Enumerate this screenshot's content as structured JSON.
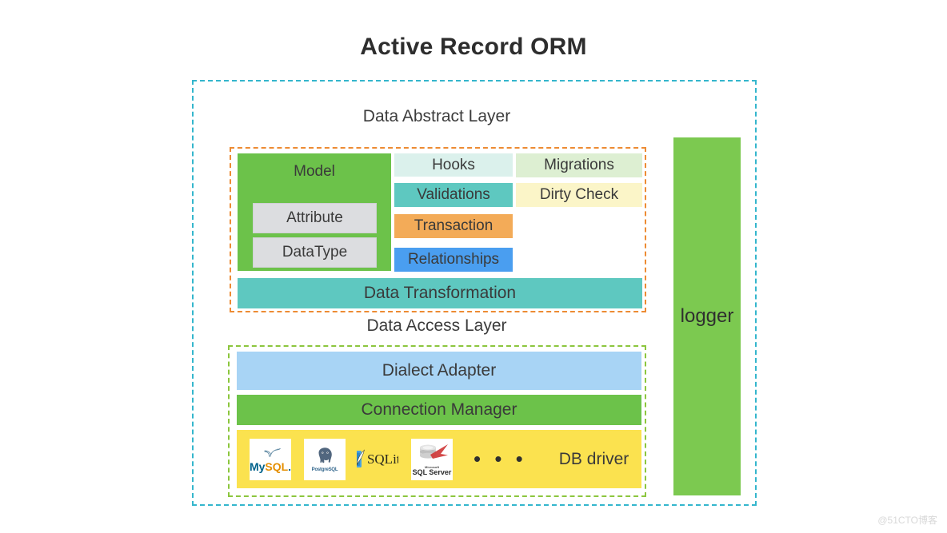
{
  "title": "Active Record ORM",
  "watermark": "@51CTO博客",
  "layers": {
    "abstract_label": "Data Abstract Layer",
    "access_label": "Data Access Layer"
  },
  "abstract_layer": {
    "model": {
      "title": "Model",
      "sub": [
        {
          "label": "Attribute"
        },
        {
          "label": "DataType"
        }
      ]
    },
    "middle_column": [
      {
        "label": "Hooks",
        "color": "#dbf1ec"
      },
      {
        "label": "Validations",
        "color": "#5ec8c0"
      },
      {
        "label": "Transaction",
        "color": "#f3ab58"
      },
      {
        "label": "Relationships",
        "color": "#4a9ef0"
      }
    ],
    "right_column": [
      {
        "label": "Migrations",
        "color": "#ddefd2"
      },
      {
        "label": "Dirty Check",
        "color": "#fbf5c8"
      }
    ],
    "transformation": {
      "label": "Data Transformation",
      "color": "#5ec8c0"
    }
  },
  "access_layer": {
    "dialect_adapter": {
      "label": "Dialect Adapter",
      "color": "#a8d4f5"
    },
    "connection_manager": {
      "label": "Connection Manager",
      "color": "#6cc24a"
    },
    "db_driver": {
      "label": "DB driver",
      "color": "#fbe24f",
      "ellipsis": "• • •",
      "logos": [
        {
          "name": "mysql-logo",
          "text": "MySQL"
        },
        {
          "name": "postgresql-logo",
          "text": "PostgreSQL"
        },
        {
          "name": "sqlite-logo",
          "text": "SQLite"
        },
        {
          "name": "sqlserver-logo",
          "text": "SQL Server"
        }
      ]
    }
  },
  "logger": {
    "label": "logger",
    "color": "#7cc950"
  },
  "borders": {
    "outer_dashed": "#34b6cd",
    "abstract_dashed": "#ed8b33",
    "access_dashed": "#8cc63e"
  }
}
